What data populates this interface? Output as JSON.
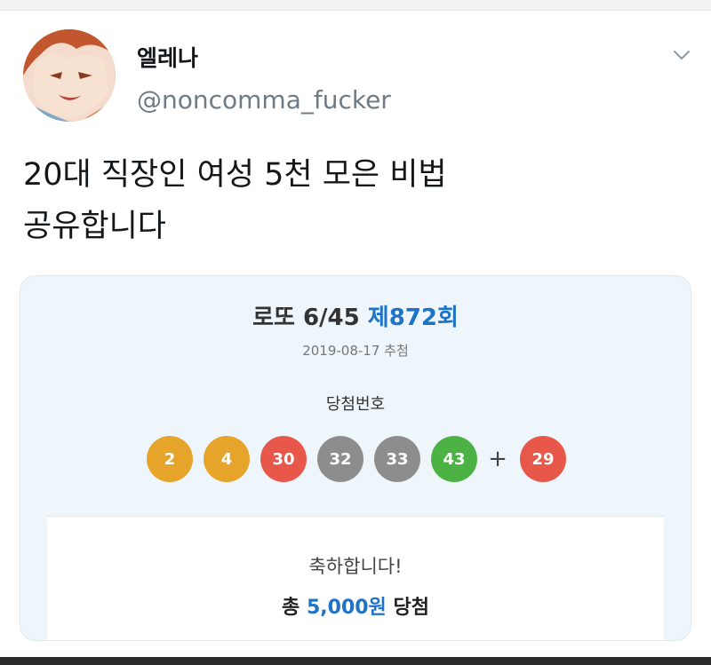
{
  "tweet": {
    "display_name": "엘레나",
    "username": "@noncomma_fucker",
    "text_line1": "20대 직장인 여성 5천 모은 비법",
    "text_line2": "공유합니다"
  },
  "card": {
    "title_prefix": "로또 6/45",
    "round": "제872회",
    "draw_date": "2019-08-17 추첨",
    "numbers_label": "당첨번호",
    "balls": [
      {
        "value": "2",
        "color": "#e6a52a"
      },
      {
        "value": "4",
        "color": "#e6a52a"
      },
      {
        "value": "30",
        "color": "#e7584a"
      },
      {
        "value": "32",
        "color": "#8d8d8d"
      },
      {
        "value": "33",
        "color": "#8d8d8d"
      },
      {
        "value": "43",
        "color": "#4cb243"
      }
    ],
    "plus": "+",
    "bonus": {
      "value": "29",
      "color": "#e7584a"
    },
    "congrats": "축하합니다!",
    "prize_prefix": "총",
    "prize_amount": "5,000원",
    "prize_suffix": "당첨"
  },
  "icons": {
    "caret": "chevron-down-icon"
  },
  "colors": {
    "accent": "#1d73c6",
    "card_bg": "#eef6fb",
    "username": "#6e7b86"
  }
}
